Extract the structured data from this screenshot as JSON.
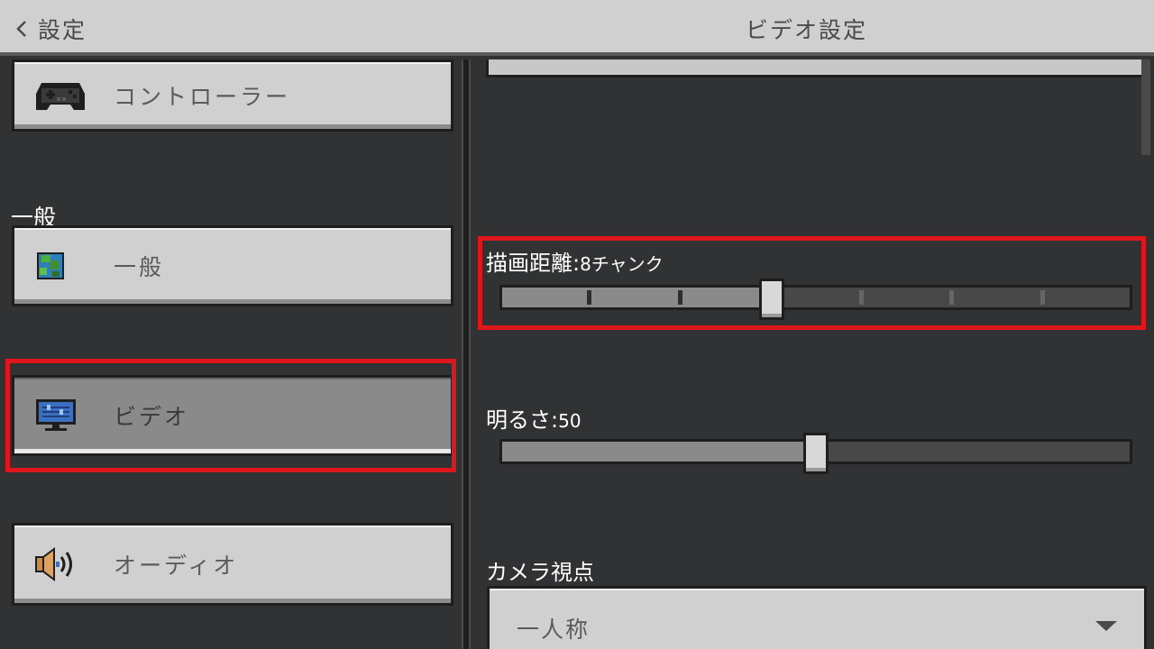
{
  "header": {
    "back_label": "設定",
    "title": "ビデオ設定"
  },
  "sidebar": {
    "section_general_label": "一般",
    "items": [
      {
        "label": "コントローラー",
        "icon": "gamepad-icon"
      },
      {
        "label": "一般",
        "icon": "globe-icon"
      },
      {
        "label": "ビデオ",
        "icon": "monitor-icon",
        "selected": true
      },
      {
        "label": "オーディオ",
        "icon": "speaker-icon"
      }
    ]
  },
  "settings": {
    "render_distance": {
      "label": "描画距離:",
      "value": "8チャンク",
      "position": 0.43
    },
    "brightness": {
      "label": "明るさ:",
      "value": "50",
      "position": 0.5
    },
    "camera": {
      "label": "カメラ視点",
      "value": "一人称"
    }
  },
  "colors": {
    "highlight": "#e0161d",
    "background": "#313233",
    "button": "#d0d0d0",
    "selected_button": "#8a8a8a"
  }
}
